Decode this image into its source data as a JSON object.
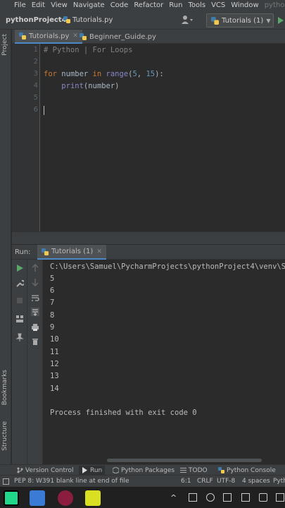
{
  "menu": [
    "File",
    "Edit",
    "View",
    "Navigate",
    "Code",
    "Refactor",
    "Run",
    "Tools",
    "VCS",
    "Window",
    "pytho"
  ],
  "nav": {
    "project": "pythonProject4",
    "file": "Tutorials.py"
  },
  "run_config": {
    "label": "Tutorials (1)"
  },
  "side_labels": {
    "project": "Project",
    "bookmarks": "Bookmarks",
    "structure": "Structure"
  },
  "tabs": [
    {
      "label": "Tutorials.py",
      "active": true
    },
    {
      "label": "Beginner_Guide.py",
      "active": false
    }
  ],
  "editor": {
    "line_numbers": [
      "1",
      "2",
      "3",
      "4",
      "5",
      "6"
    ],
    "lines": [
      {
        "parts": [
          {
            "t": "# Python | For Loops",
            "c": "cmt"
          }
        ]
      },
      {
        "parts": []
      },
      {
        "parts": [
          {
            "t": "for",
            "c": "kw"
          },
          {
            "t": " number ",
            "c": ""
          },
          {
            "t": "in",
            "c": "kw"
          },
          {
            "t": " ",
            "c": ""
          },
          {
            "t": "range",
            "c": "bi"
          },
          {
            "t": "(",
            "c": ""
          },
          {
            "t": "5",
            "c": "num"
          },
          {
            "t": ", ",
            "c": ""
          },
          {
            "t": "15",
            "c": "num"
          },
          {
            "t": "):",
            "c": ""
          }
        ]
      },
      {
        "parts": [
          {
            "t": "    ",
            "c": ""
          },
          {
            "t": "print",
            "c": "bi"
          },
          {
            "t": "(number)",
            "c": ""
          }
        ]
      },
      {
        "parts": []
      },
      {
        "parts": []
      }
    ]
  },
  "run": {
    "title": "Run:",
    "tab_label": "Tutorials (1)",
    "console": [
      "C:\\Users\\Samuel\\PycharmProjects\\pythonProject4\\venv\\S",
      "5",
      "6",
      "7",
      "8",
      "9",
      "10",
      "11",
      "12",
      "13",
      "14",
      "",
      "Process finished with exit code 0"
    ]
  },
  "bottom_tools": [
    {
      "label": "Version Control",
      "active": false
    },
    {
      "label": "Run",
      "active": true
    },
    {
      "label": "Python Packages",
      "active": false
    },
    {
      "label": "TODO",
      "active": false
    },
    {
      "label": "Python Console",
      "active": false
    }
  ],
  "status": {
    "message": "PEP 8: W391 blank line at end of file",
    "position": "6:1",
    "line_sep": "CRLF",
    "encoding": "UTF-8",
    "indent": "4 spaces",
    "interpreter": "Pyth"
  },
  "colors": {
    "accent": "#4a88c7",
    "run_green": "#59a869",
    "keyword": "#cc7832",
    "builtin": "#8888c6",
    "number": "#6897bb",
    "comment": "#808080"
  }
}
